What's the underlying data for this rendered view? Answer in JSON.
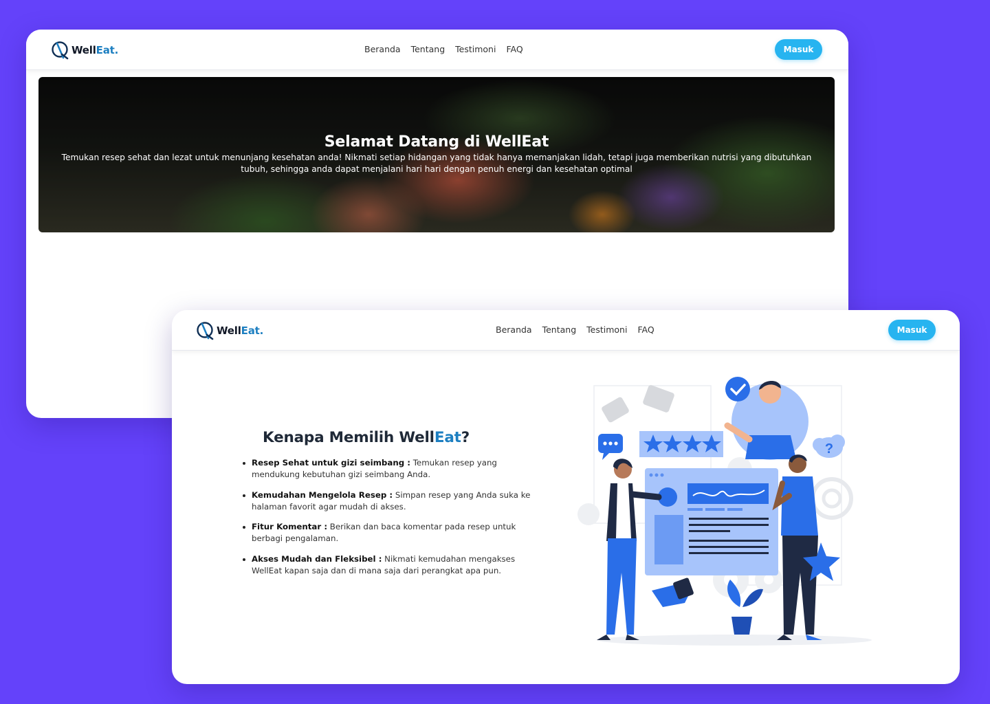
{
  "brand": {
    "name_part1": "Well",
    "name_part2": "Eat."
  },
  "nav": {
    "links": [
      "Beranda",
      "Tentang",
      "Testimoni",
      "FAQ"
    ],
    "login_label": "Masuk"
  },
  "hero": {
    "title": "Selamat Datang di WellEat",
    "description": "Temukan resep sehat dan lezat untuk menunjang kesehatan anda! Nikmati setiap hidangan yang tidak hanya memanjakan lidah, tetapi juga memberikan nutrisi yang dibutuhkan tubuh, sehingga anda dapat menjalani hari hari dengan penuh energi dan kesehatan optimal"
  },
  "why": {
    "title_prefix": "Kenapa Memilih Well",
    "title_accent": "Eat",
    "title_suffix": "?",
    "features": [
      {
        "title": "Resep Sehat untuk gizi seimbang :",
        "text": "Temukan resep yang mendukung kebutuhan gizi seimbang Anda."
      },
      {
        "title": "Kemudahan Mengelola Resep :",
        "text": "Simpan resep yang Anda suka ke halaman favorit agar mudah di akses."
      },
      {
        "title": "Fitur Komentar :",
        "text": "Berikan dan baca komentar pada resep untuk berbagi pengalaman."
      },
      {
        "title": "Akses Mudah dan Fleksibel :",
        "text": "Nikmati kemudahan mengakses WellEat kapan saja dan di mana saja dari perangkat apa pun."
      }
    ]
  },
  "illustration": {
    "question_mark": "?"
  },
  "colors": {
    "background": "#6442fa",
    "brand_accent": "#1d7fc1",
    "button": "#27b4f0",
    "illustration_blue": "#2a6ee8"
  },
  "icons": [
    "logo-icon",
    "chat-bubble-icon",
    "star-icon",
    "checkmark-icon",
    "question-cloud-icon",
    "thumbs-up-icon",
    "gear-icon"
  ]
}
